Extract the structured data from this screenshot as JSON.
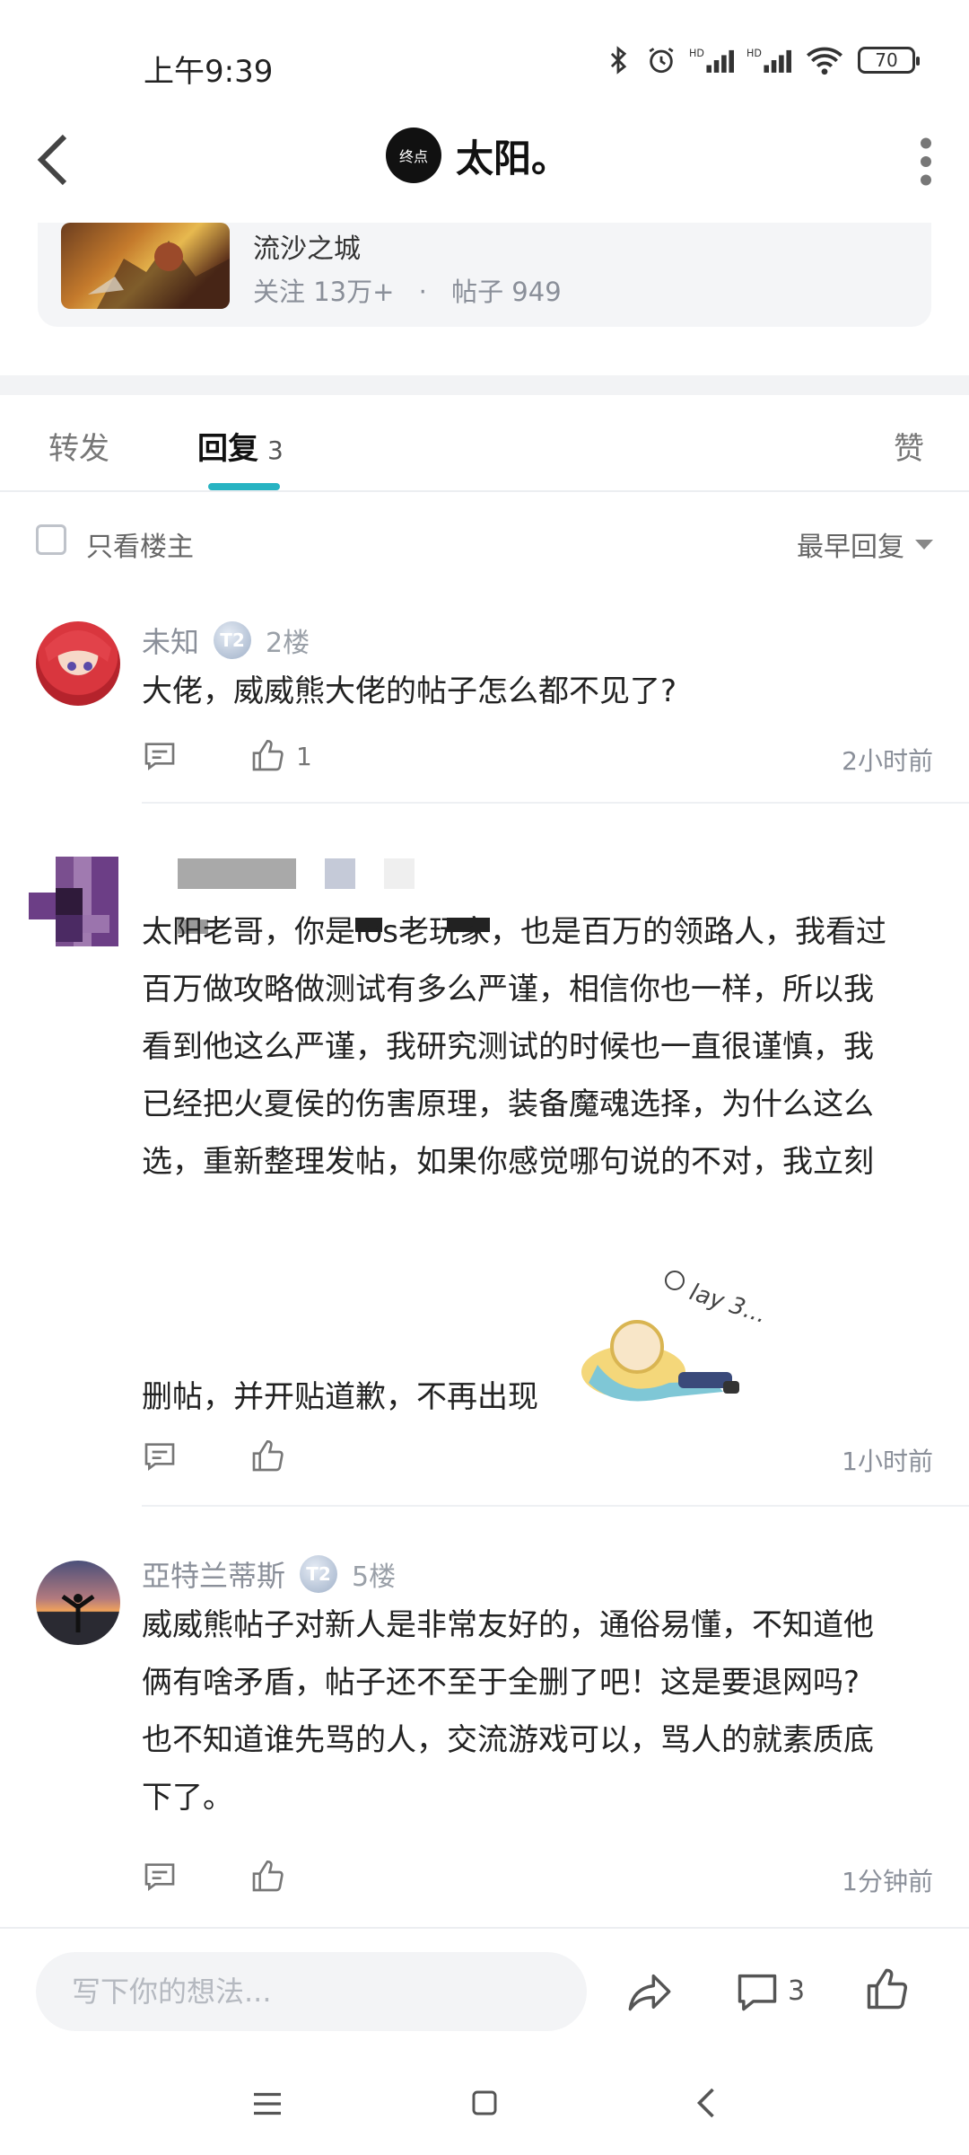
{
  "status_bar": {
    "time": "上午9:39",
    "battery": "70",
    "icons": [
      "bluetooth-icon",
      "alarm-icon",
      "hd-signal-icon",
      "hd-signal-icon",
      "wifi-icon",
      "battery-icon"
    ]
  },
  "header": {
    "title": "太阳。",
    "avatar_text": "终点"
  },
  "forum": {
    "name": "流沙之城",
    "followers": "关注 13万+",
    "dot": "·",
    "posts": "帖子 949"
  },
  "tabs": {
    "forward": "转发",
    "reply": "回复",
    "reply_count": "3",
    "like": "赞"
  },
  "filter": {
    "only_op": "只看楼主",
    "sort": "最早回复"
  },
  "comments": [
    {
      "user": "未知",
      "badge": "T2",
      "floor": "2楼",
      "text": "大佬，威威熊大佬的帖子怎么都不见了?",
      "likes": "1",
      "time": "2小时前"
    },
    {
      "user": "",
      "floor": "",
      "text_lines": [
        "太阳老哥，你是ios老玩家，也是百万的领路人，我看过",
        "百万做攻略做测试有多么严谨，相信你也一样，所以我",
        "看到他这么严谨，我研究测试的时候也一直很谨慎，我",
        "已经把火夏侯的伤害原理，装备魔魂选择，为什么这么",
        "选，重新整理发帖，如果你感觉哪句说的不对，我立刻"
      ],
      "last_line": "删帖，并开贴道歉，不再出现",
      "sticker_text": "lay 3...",
      "likes": "",
      "time": "1小时前"
    },
    {
      "user": "亞特兰蒂斯",
      "badge": "T2",
      "floor": "5楼",
      "text_lines": [
        "威威熊帖子对新人是非常友好的，通俗易懂，不知道他",
        "俩有啥矛盾，帖子还不至于全删了吧！这是要退网吗?",
        "也不知道谁先骂的人，交流游戏可以，骂人的就素质底",
        "下了。"
      ],
      "likes": "",
      "time": "1分钟前"
    }
  ],
  "bottom_bar": {
    "placeholder": "写下你的想法...",
    "comment_count": "3"
  },
  "colors": {
    "accent": "#27b3c2",
    "muted_text": "#8a8f99"
  }
}
